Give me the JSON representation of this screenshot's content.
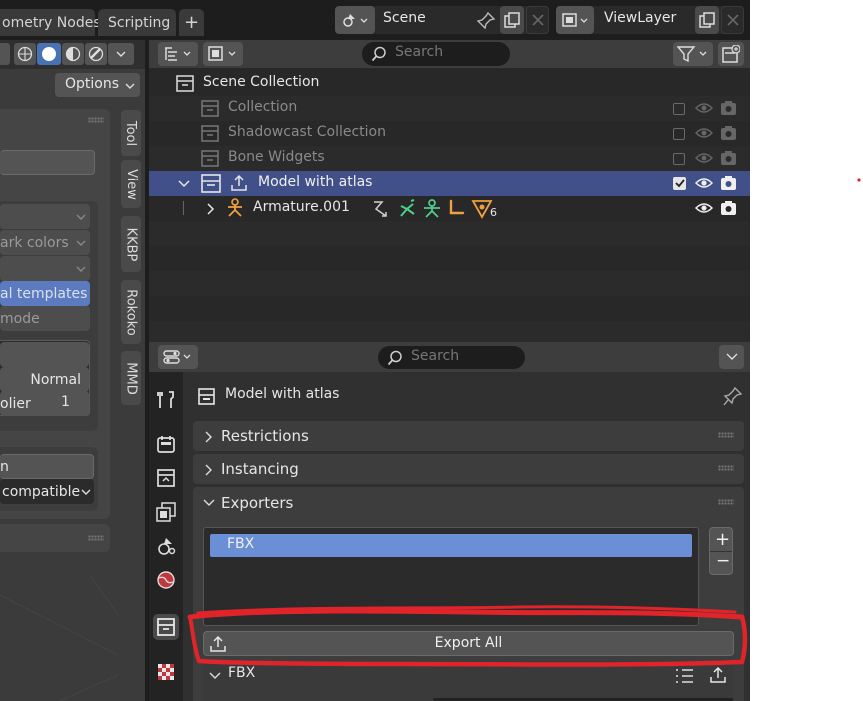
{
  "topbar": {
    "tabs": [
      "ometry Nodes",
      "Scripting"
    ],
    "add_tab": "+",
    "scene_name": "Scene",
    "view_layer": "ViewLayer"
  },
  "left_panel": {
    "options_label": "Options",
    "fields": [
      "ark colors",
      "al templates",
      "mode",
      "Normal",
      "olier",
      "1",
      "n",
      "compatible"
    ],
    "vertical_tabs": [
      "Tool",
      "View",
      "KKBP",
      "Rokoko",
      "MMD"
    ]
  },
  "outliner": {
    "search_placeholder": "Search",
    "rows": [
      {
        "label": "Scene Collection"
      },
      {
        "label": "Collection"
      },
      {
        "label": "Shadowcast Collection"
      },
      {
        "label": "Bone Widgets"
      },
      {
        "label": "Model with atlas"
      },
      {
        "label": "Armature.001",
        "badge": "6"
      }
    ]
  },
  "properties": {
    "search_placeholder": "Search",
    "collection_name": "Model with atlas",
    "panels": [
      "Restrictions",
      "Instancing",
      "Exporters"
    ],
    "exporter_items": [
      "FBX"
    ],
    "add_label": "+",
    "remove_label": "−",
    "export_all_label": "Export All",
    "fbx_subpanel": "FBX"
  },
  "colors": {
    "accent": "#6b8fd6",
    "selected_row": "#42508a",
    "annotation_red": "#e0242a"
  }
}
